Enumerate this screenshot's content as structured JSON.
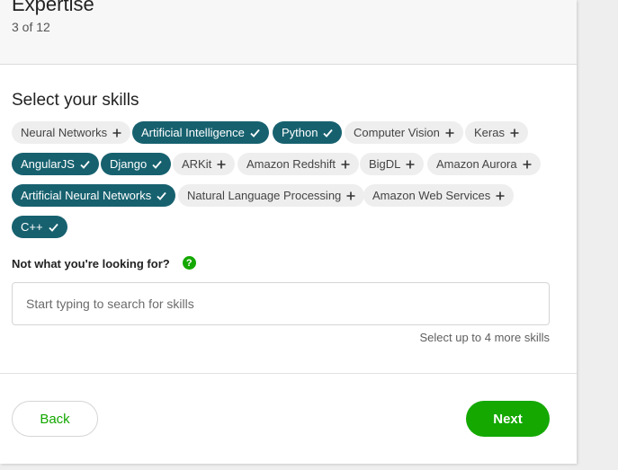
{
  "header": {
    "title": "Expertise",
    "step": "3 of 12"
  },
  "skills": {
    "title": "Select your skills",
    "chips": [
      {
        "label": "Neural Networks",
        "selected": false
      },
      {
        "label": "Artificial Intelligence",
        "selected": true
      },
      {
        "label": "Python",
        "selected": true
      },
      {
        "label": "Computer Vision",
        "selected": false
      },
      {
        "label": "Keras",
        "selected": false
      },
      {
        "label": "AngularJS",
        "selected": true
      },
      {
        "label": "Django",
        "selected": true
      },
      {
        "label": "ARKit",
        "selected": false
      },
      {
        "label": "Amazon Redshift",
        "selected": false
      },
      {
        "label": "BigDL",
        "selected": false
      },
      {
        "label": "Amazon Aurora",
        "selected": false
      },
      {
        "label": "Artificial Neural Networks",
        "selected": true
      },
      {
        "label": "Natural Language Processing",
        "selected": false
      },
      {
        "label": "Amazon Web Services",
        "selected": false
      },
      {
        "label": "C++",
        "selected": true
      }
    ]
  },
  "search": {
    "label": "Not what you're looking for?",
    "help_icon": "?",
    "placeholder": "Start typing to search for skills",
    "value": "",
    "hint": "Select up to 4 more skills"
  },
  "footer": {
    "back_label": "Back",
    "next_label": "Next"
  },
  "colors": {
    "selected_chip": "#17616f",
    "unselected_chip": "#eeeeee",
    "primary_green": "#14a800"
  }
}
